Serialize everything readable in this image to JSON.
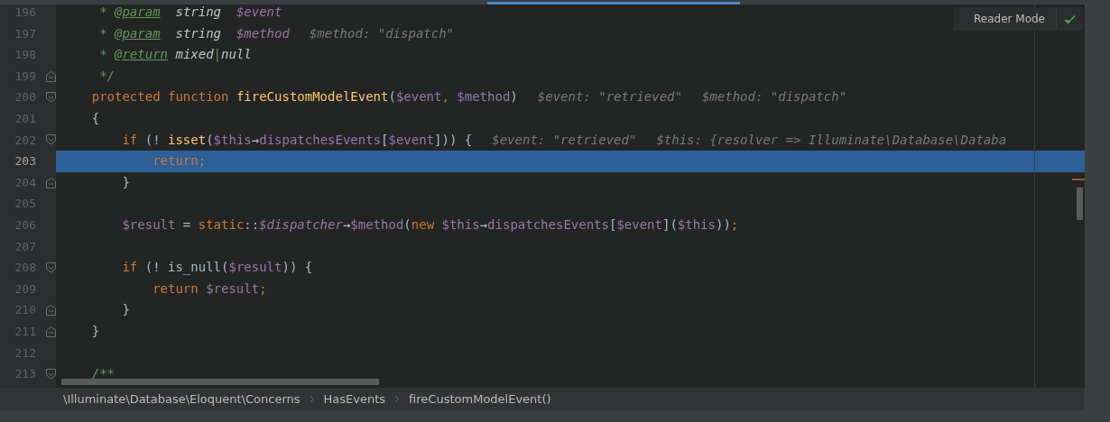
{
  "editor": {
    "lines": [
      {
        "number": "196",
        "fold_start": false,
        "fold_end": false,
        "current": false,
        "tokens": [
          {
            "t": "     * ",
            "kind": "doc"
          },
          {
            "t": "@param",
            "kind": "tag"
          },
          {
            "t": "  string  ",
            "kind": "doctype"
          },
          {
            "t": "$event",
            "kind": "docvar"
          }
        ]
      },
      {
        "number": "197",
        "fold_start": false,
        "fold_end": false,
        "current": false,
        "tokens": [
          {
            "t": "     * ",
            "kind": "doc"
          },
          {
            "t": "@param",
            "kind": "tag"
          },
          {
            "t": "  string  ",
            "kind": "doctype"
          },
          {
            "t": "$method",
            "kind": "docvar"
          }
        ],
        "hints": [
          "$method: \"dispatch\""
        ]
      },
      {
        "number": "198",
        "fold_start": false,
        "fold_end": false,
        "current": false,
        "tokens": [
          {
            "t": "     * ",
            "kind": "doc"
          },
          {
            "t": "@return",
            "kind": "tag"
          },
          {
            "t": " mixed",
            "kind": "doctype"
          },
          {
            "t": "|",
            "kind": "doc"
          },
          {
            "t": "null",
            "kind": "doctype"
          }
        ]
      },
      {
        "number": "199",
        "fold_start": false,
        "fold_end": true,
        "current": false,
        "tokens": [
          {
            "t": "     */",
            "kind": "doc"
          }
        ]
      },
      {
        "number": "200",
        "fold_start": true,
        "fold_end": false,
        "current": false,
        "tokens": [
          {
            "t": "    protected function ",
            "kind": "kw"
          },
          {
            "t": "fireCustomModelEvent",
            "kind": "fn"
          },
          {
            "t": "(",
            "kind": "plain"
          },
          {
            "t": "$event",
            "kind": "var"
          },
          {
            "t": ", ",
            "kind": "kw"
          },
          {
            "t": "$method",
            "kind": "var"
          },
          {
            "t": ")",
            "kind": "plain"
          }
        ],
        "hints": [
          "$event: \"retrieved\"",
          "$method: \"dispatch\""
        ]
      },
      {
        "number": "201",
        "fold_start": false,
        "fold_end": false,
        "current": false,
        "tokens": [
          {
            "t": "    {",
            "kind": "plain"
          }
        ]
      },
      {
        "number": "202",
        "fold_start": true,
        "fold_end": false,
        "current": false,
        "tokens": [
          {
            "t": "        if ",
            "kind": "kw"
          },
          {
            "t": "(! ",
            "kind": "plain"
          },
          {
            "t": "isset",
            "kind": "fn"
          },
          {
            "t": "(",
            "kind": "plain"
          },
          {
            "t": "$this",
            "kind": "var"
          },
          {
            "t": "→",
            "kind": "plain"
          },
          {
            "t": "dispatchesEvents",
            "kind": "var"
          },
          {
            "t": "[",
            "kind": "plain"
          },
          {
            "t": "$event",
            "kind": "var"
          },
          {
            "t": "])) {",
            "kind": "plain"
          }
        ],
        "hints": [
          "$event: \"retrieved\"",
          "$this: {resolver => Illuminate\\Database\\Databa"
        ]
      },
      {
        "number": "203",
        "fold_start": false,
        "fold_end": false,
        "current": true,
        "tokens": [
          {
            "t": "            return;",
            "kind": "kw"
          }
        ]
      },
      {
        "number": "204",
        "fold_start": false,
        "fold_end": true,
        "current": false,
        "tokens": [
          {
            "t": "        }",
            "kind": "plain"
          }
        ]
      },
      {
        "number": "205",
        "fold_start": false,
        "fold_end": false,
        "current": false
      },
      {
        "number": "206",
        "fold_start": false,
        "fold_end": false,
        "current": false,
        "tokens": [
          {
            "t": "        $result",
            "kind": "var"
          },
          {
            "t": " = ",
            "kind": "plain"
          },
          {
            "t": "static",
            "kind": "kw"
          },
          {
            "t": "::",
            "kind": "plain"
          },
          {
            "t": "$dispatcher",
            "kind": "svar"
          },
          {
            "t": "→",
            "kind": "plain"
          },
          {
            "t": "$method",
            "kind": "var"
          },
          {
            "t": "(",
            "kind": "plain"
          },
          {
            "t": "new ",
            "kind": "kw"
          },
          {
            "t": "$this",
            "kind": "var"
          },
          {
            "t": "→",
            "kind": "plain"
          },
          {
            "t": "dispatchesEvents",
            "kind": "var"
          },
          {
            "t": "[",
            "kind": "plain"
          },
          {
            "t": "$event",
            "kind": "var"
          },
          {
            "t": "](",
            "kind": "plain"
          },
          {
            "t": "$this",
            "kind": "var"
          },
          {
            "t": "))",
            "kind": "plain"
          },
          {
            "t": ";",
            "kind": "kw"
          }
        ]
      },
      {
        "number": "207",
        "fold_start": false,
        "fold_end": false,
        "current": false
      },
      {
        "number": "208",
        "fold_start": true,
        "fold_end": false,
        "current": false,
        "tokens": [
          {
            "t": "        if ",
            "kind": "kw"
          },
          {
            "t": "(! ",
            "kind": "plain"
          },
          {
            "t": "is_null",
            "kind": "plain"
          },
          {
            "t": "(",
            "kind": "plain"
          },
          {
            "t": "$result",
            "kind": "var"
          },
          {
            "t": ")) {",
            "kind": "plain"
          }
        ]
      },
      {
        "number": "209",
        "fold_start": false,
        "fold_end": false,
        "current": false,
        "tokens": [
          {
            "t": "            return ",
            "kind": "kw"
          },
          {
            "t": "$result",
            "kind": "var"
          },
          {
            "t": ";",
            "kind": "kw"
          }
        ]
      },
      {
        "number": "210",
        "fold_start": false,
        "fold_end": true,
        "current": false,
        "tokens": [
          {
            "t": "        }",
            "kind": "plain"
          }
        ]
      },
      {
        "number": "211",
        "fold_start": false,
        "fold_end": true,
        "current": false,
        "tokens": [
          {
            "t": "    }",
            "kind": "plain"
          }
        ]
      },
      {
        "number": "212",
        "fold_start": false,
        "fold_end": false,
        "current": false
      },
      {
        "number": "213",
        "fold_start": true,
        "fold_end": false,
        "current": false,
        "tokens": [
          {
            "t": "    /**",
            "kind": "doc"
          }
        ]
      }
    ]
  },
  "reader_mode": {
    "label": "Reader Mode"
  },
  "breadcrumbs": [
    "\\Illuminate\\Database\\Eloquent\\Concerns",
    "HasEvents",
    "fireCustomModelEvent()"
  ]
}
